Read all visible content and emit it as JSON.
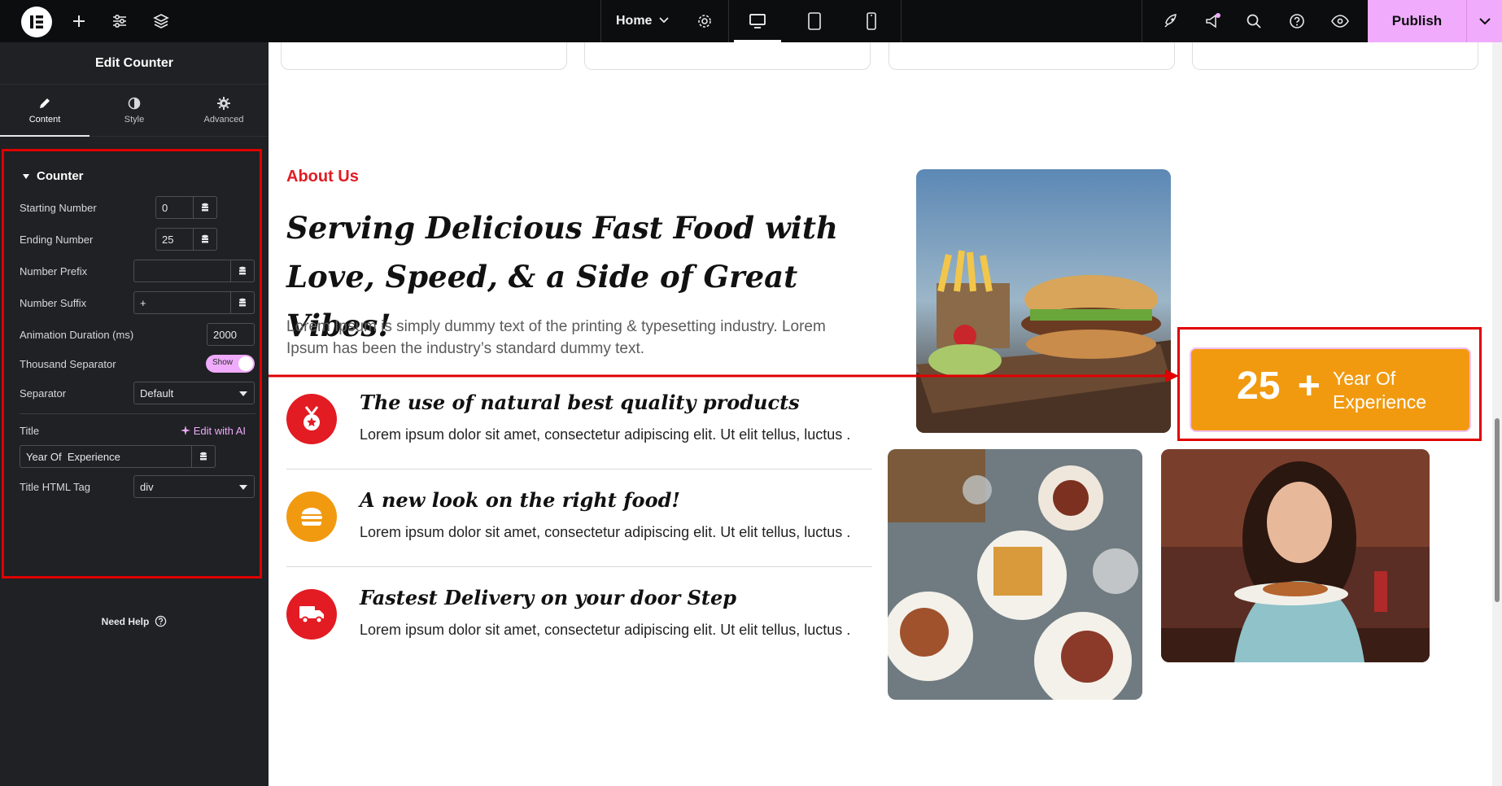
{
  "topbar": {
    "page_name": "Home",
    "publish_label": "Publish",
    "icons": [
      "elementor-logo-icon",
      "add-icon",
      "settings-sliders-icon",
      "layers-icon",
      "chevron-down-icon",
      "gear-icon",
      "desktop-icon",
      "tablet-icon",
      "mobile-icon",
      "rocket-icon",
      "megaphone-icon",
      "search-icon",
      "help-icon",
      "eye-icon"
    ]
  },
  "panel": {
    "title": "Edit Counter",
    "tabs": [
      {
        "label": "Content"
      },
      {
        "label": "Style"
      },
      {
        "label": "Advanced"
      }
    ],
    "section": "Counter",
    "fields": {
      "starting_number": {
        "label": "Starting Number",
        "value": "0"
      },
      "ending_number": {
        "label": "Ending Number",
        "value": "25"
      },
      "number_prefix": {
        "label": "Number Prefix",
        "value": ""
      },
      "number_suffix": {
        "label": "Number Suffix",
        "value": "+"
      },
      "animation_duration": {
        "label": "Animation Duration (ms)",
        "value": "2000"
      },
      "thousand_separator": {
        "label": "Thousand Separator",
        "value": "Show"
      },
      "separator": {
        "label": "Separator",
        "value": "Default"
      },
      "title": {
        "label": "Title",
        "value": "Year Of  Experience",
        "ai_label": "Edit with AI"
      },
      "title_html_tag": {
        "label": "Title HTML Tag",
        "value": "div"
      }
    },
    "need_help": "Need Help"
  },
  "canvas": {
    "eyebrow": "About Us",
    "headline": "Serving Delicious Fast Food with Love, Speed, & a Side of Great Vibes!",
    "intro": "Lorem Ipsum is simply dummy text of the printing & typesetting industry. Lorem Ipsum has been the industry’s standard dummy text.",
    "features": [
      {
        "title": "The use of natural best quality products",
        "text": "Lorem ipsum dolor sit amet, consectetur adipiscing elit. Ut elit tellus, luctus .",
        "icon": "medal-icon",
        "color": "#e31b23"
      },
      {
        "title": "A new look on the right food!",
        "text": "Lorem ipsum dolor sit amet, consectetur adipiscing elit. Ut elit tellus, luctus .",
        "icon": "burger-icon",
        "color": "#f19a10"
      },
      {
        "title": "Fastest Delivery on your door Step",
        "text": "Lorem ipsum dolor sit amet, consectetur adipiscing elit. Ut elit tellus, luctus .",
        "icon": "truck-icon",
        "color": "#e31b23"
      }
    ],
    "counter": {
      "number": "25",
      "suffix": "+",
      "title": "Year Of Experience"
    }
  },
  "colors": {
    "accent": "#f0abfc",
    "brand_red": "#e31b23",
    "brand_orange": "#f19a10",
    "highlight": "#e00000"
  }
}
